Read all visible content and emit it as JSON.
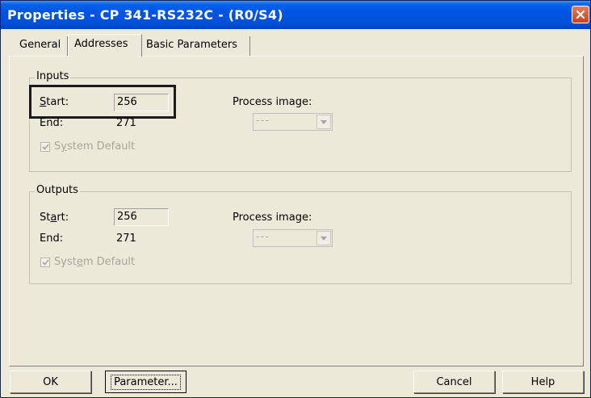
{
  "window": {
    "title": "Properties - CP 341-RS232C - (R0/S4)",
    "close_icon": "close-icon"
  },
  "tabs": [
    {
      "label": "General",
      "selected": false
    },
    {
      "label": "Addresses",
      "selected": true
    },
    {
      "label": "Basic Parameters",
      "selected": false
    }
  ],
  "inputs": {
    "legend": "Inputs",
    "start_label_u": "S",
    "start_label_rest": "tart:",
    "start_value": "256",
    "end_label": "End:",
    "end_value": "271",
    "process_image_label": "Process image:",
    "process_image_value": "---",
    "system_default_pre": "S",
    "system_default_u": "y",
    "system_default_post": "stem Default",
    "system_default_checked": true
  },
  "outputs": {
    "legend": "Outputs",
    "start_label_pre": "St",
    "start_label_u": "a",
    "start_label_post": "rt:",
    "start_value": "256",
    "end_label": "End:",
    "end_value": "271",
    "process_image_label": "Process image:",
    "process_image_value": "---",
    "system_default_pre": "Syst",
    "system_default_u": "e",
    "system_default_post": "m Default",
    "system_default_checked": true
  },
  "buttons": {
    "ok": "OK",
    "parameter": "Parameter...",
    "cancel": "Cancel",
    "help": "Help"
  }
}
